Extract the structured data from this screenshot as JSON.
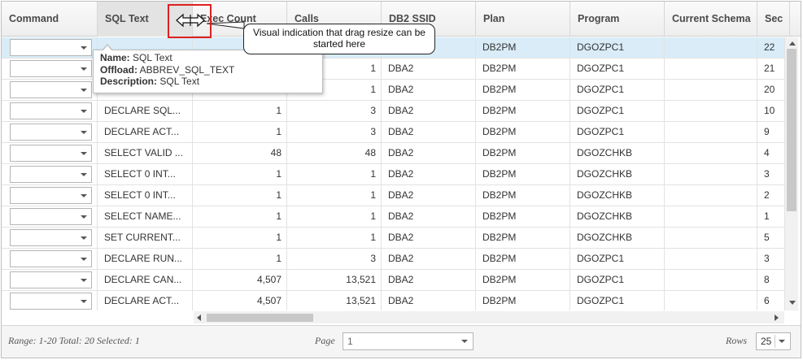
{
  "columns": [
    "Command",
    "SQL Text",
    "Exec Count",
    "Calls",
    "DB2 SSID",
    "Plan",
    "Program",
    "Current Schema",
    "Sec"
  ],
  "rows": [
    {
      "sql": "",
      "exec": "",
      "calls": "",
      "ssid": "",
      "plan": "DB2PM",
      "program": "DGOZPC1",
      "schema": "",
      "sec": "22",
      "selected": true
    },
    {
      "sql": "",
      "exec": "",
      "calls": "1",
      "ssid": "DBA2",
      "plan": "DB2PM",
      "program": "DGOZPC1",
      "schema": "",
      "sec": "21"
    },
    {
      "sql": "",
      "exec": "",
      "calls": "1",
      "ssid": "DBA2",
      "plan": "DB2PM",
      "program": "DGOZPC1",
      "schema": "",
      "sec": "20"
    },
    {
      "sql": "DECLARE SQL...",
      "exec": "1",
      "calls": "3",
      "ssid": "DBA2",
      "plan": "DB2PM",
      "program": "DGOZPC1",
      "schema": "",
      "sec": "10"
    },
    {
      "sql": "DECLARE ACT...",
      "exec": "1",
      "calls": "3",
      "ssid": "DBA2",
      "plan": "DB2PM",
      "program": "DGOZPC1",
      "schema": "",
      "sec": "9"
    },
    {
      "sql": "SELECT VALID ...",
      "exec": "48",
      "calls": "48",
      "ssid": "DBA2",
      "plan": "DB2PM",
      "program": "DGOZCHKB",
      "schema": "",
      "sec": "4"
    },
    {
      "sql": "SELECT 0 INT...",
      "exec": "1",
      "calls": "1",
      "ssid": "DBA2",
      "plan": "DB2PM",
      "program": "DGOZCHKB",
      "schema": "",
      "sec": "3"
    },
    {
      "sql": "SELECT 0 INT...",
      "exec": "1",
      "calls": "1",
      "ssid": "DBA2",
      "plan": "DB2PM",
      "program": "DGOZCHKB",
      "schema": "",
      "sec": "2"
    },
    {
      "sql": "SELECT NAME...",
      "exec": "1",
      "calls": "1",
      "ssid": "DBA2",
      "plan": "DB2PM",
      "program": "DGOZCHKB",
      "schema": "",
      "sec": "1"
    },
    {
      "sql": "SET CURRENT...",
      "exec": "1",
      "calls": "1",
      "ssid": "DBA2",
      "plan": "DB2PM",
      "program": "DGOZCHKB",
      "schema": "",
      "sec": "5"
    },
    {
      "sql": "DECLARE RUN...",
      "exec": "1",
      "calls": "3",
      "ssid": "DBA2",
      "plan": "DB2PM",
      "program": "DGOZPC1",
      "schema": "",
      "sec": "3"
    },
    {
      "sql": "DECLARE CAN...",
      "exec": "4,507",
      "calls": "13,521",
      "ssid": "DBA2",
      "plan": "DB2PM",
      "program": "DGOZPC1",
      "schema": "",
      "sec": "8"
    },
    {
      "sql": "DECLARE ACT...",
      "exec": "4,507",
      "calls": "13,521",
      "ssid": "DBA2",
      "plan": "DB2PM",
      "program": "DGOZPC1",
      "schema": "",
      "sec": "6"
    }
  ],
  "tooltip": {
    "name_label": "Name:",
    "name_value": "SQL Text",
    "offload_label": "Offload:",
    "offload_value": "ABBREV_SQL_TEXT",
    "description_label": "Description:",
    "description_value": "SQL Text"
  },
  "callout": {
    "text": "Visual indication that drag resize can be started here"
  },
  "footer": {
    "range_text": "Range: 1-20 Total: 20 Selected: 1",
    "page_label": "Page",
    "page_value": "1",
    "rows_label": "Rows",
    "rows_value": "25"
  },
  "colors": {
    "selected_row": "#d9ecf8",
    "highlight_box": "#e02020"
  }
}
